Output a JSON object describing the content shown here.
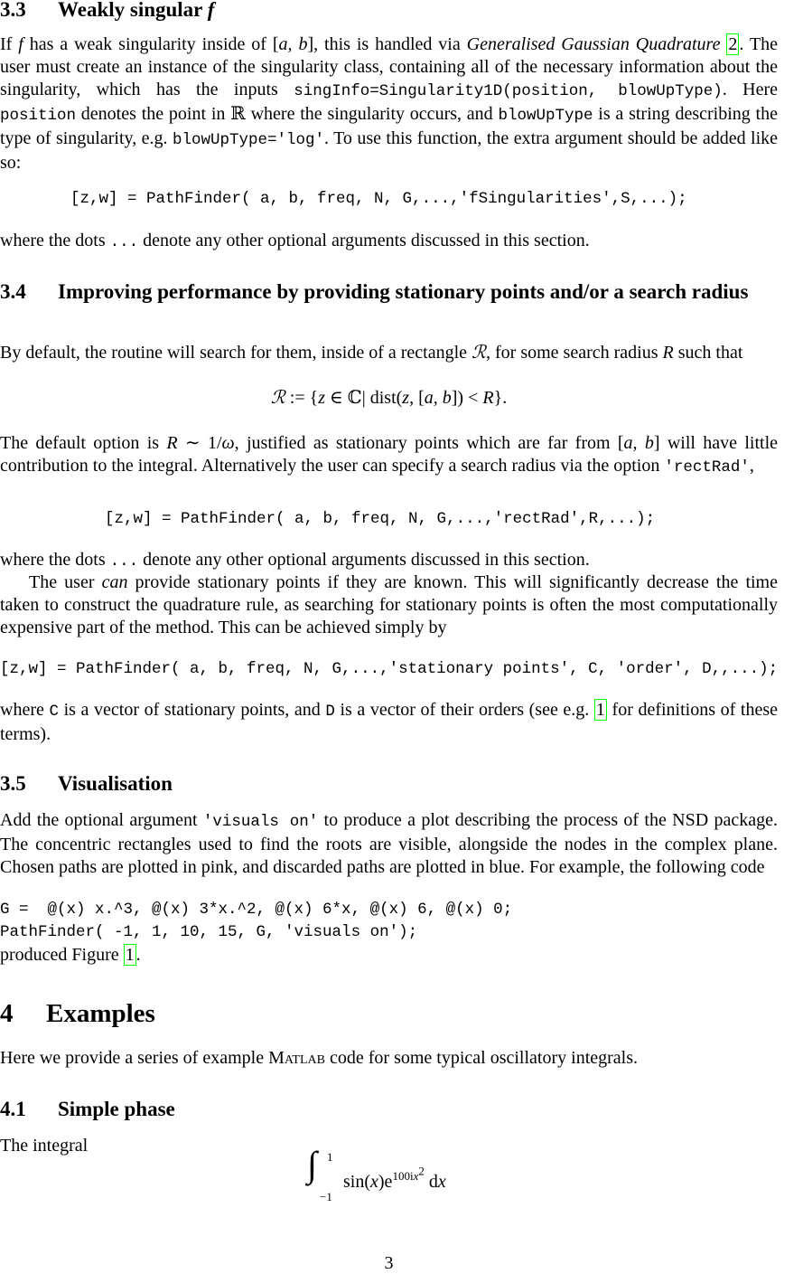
{
  "sections": {
    "s33": {
      "num": "3.3",
      "title": "Weakly singular ",
      "title_math": "f"
    },
    "s34": {
      "num": "3.4",
      "title": "Improving performance by providing stationary points and/or a search radius"
    },
    "s35": {
      "num": "3.5",
      "title": "Visualisation"
    },
    "s4": {
      "num": "4",
      "title": "Examples"
    },
    "s41": {
      "num": "4.1",
      "title": "Simple phase"
    }
  },
  "paras": {
    "p1": [
      [
        "n",
        "If "
      ],
      [
        "m",
        "f"
      ],
      [
        "n",
        " has a weak singularity inside of ["
      ],
      [
        "m",
        "a, b"
      ],
      [
        "n",
        "], this is handled via "
      ],
      [
        "i",
        "Generalised Gaussian Quadrature"
      ],
      [
        "n",
        " "
      ],
      [
        "cite",
        "2"
      ],
      [
        "n",
        ". The user must create an instance of the singularity class, containing all of the necessary information about the singularity, which has the inputs "
      ],
      [
        "c",
        "singInfo=Singularity1D(position, blowUpType)"
      ],
      [
        "n",
        ". Here "
      ],
      [
        "c",
        "position"
      ],
      [
        "n",
        " denotes the point in ℝ where the singularity occurs, and "
      ],
      [
        "c",
        "blowUpType"
      ],
      [
        "n",
        " is a string describing the type of singularity, e.g. "
      ],
      [
        "c",
        "blowUpType='log'"
      ],
      [
        "n",
        ". To use this function, the extra argument should be added like so:"
      ]
    ],
    "p2": [
      [
        "n",
        "where the dots "
      ],
      [
        "c",
        "..."
      ],
      [
        "n",
        " denote any other optional arguments discussed in this section."
      ]
    ],
    "p3": [
      [
        "n",
        "By default, the routine will search for them, inside of a rectangle "
      ],
      [
        "m",
        "ℛ"
      ],
      [
        "n",
        ", for some search radius "
      ],
      [
        "m",
        "R"
      ],
      [
        "n",
        " such that"
      ]
    ],
    "p3math": [
      [
        "m",
        "ℛ"
      ],
      [
        "n",
        " := {"
      ],
      [
        "m",
        "z"
      ],
      [
        "n",
        " ∈ ℂ| dist("
      ],
      [
        "m",
        "z"
      ],
      [
        "n",
        ", ["
      ],
      [
        "m",
        "a, b"
      ],
      [
        "n",
        "]) < "
      ],
      [
        "m",
        "R"
      ],
      [
        "n",
        "}."
      ]
    ],
    "p4": [
      [
        "n",
        "The default option is "
      ],
      [
        "m",
        "R"
      ],
      [
        "n",
        " ∼ 1/"
      ],
      [
        "m",
        "ω"
      ],
      [
        "n",
        ", justified as stationary points which are far from ["
      ],
      [
        "m",
        "a, b"
      ],
      [
        "n",
        "] will have little contribution to the integral.  Alternatively the user can specify a search radius via the option "
      ],
      [
        "c",
        "'rectRad'"
      ],
      [
        "n",
        ","
      ]
    ],
    "p5": [
      [
        "n",
        "where the dots "
      ],
      [
        "c",
        "..."
      ],
      [
        "n",
        " denote any other optional arguments discussed in this section."
      ]
    ],
    "p6": [
      [
        "n",
        "The user "
      ],
      [
        "i",
        "can"
      ],
      [
        "n",
        " provide stationary points if they are known.  This will significantly decrease the time taken to construct the quadrature rule, as searching for stationary points is often the most computationally expensive part of the method. This can be achieved simply by"
      ]
    ],
    "p7": [
      [
        "n",
        "where "
      ],
      [
        "c",
        "C"
      ],
      [
        "n",
        " is a vector of stationary points, and "
      ],
      [
        "c",
        "D"
      ],
      [
        "n",
        " is a vector of their orders (see e.g. "
      ],
      [
        "cite",
        "1"
      ],
      [
        "n",
        " for definitions of these terms)."
      ]
    ],
    "p8": [
      [
        "n",
        "Add the optional argument "
      ],
      [
        "c",
        "'visuals on'"
      ],
      [
        "n",
        " to produce a plot describing the process of the NSD package. The concentric rectangles used to find the roots are visible, alongside the nodes in the complex plane. Chosen paths are plotted in pink, and discarded paths are plotted in blue. For example, the following code"
      ]
    ],
    "p9": [
      [
        "n",
        "produced Figure "
      ],
      [
        "cite",
        "1"
      ],
      [
        "n",
        "."
      ]
    ],
    "p10": [
      [
        "n",
        "Here we provide a series of example "
      ],
      [
        "sc",
        "Matlab"
      ],
      [
        "n",
        " code for some typical oscillatory integrals."
      ]
    ],
    "p11": [
      [
        "n",
        "The integral"
      ]
    ]
  },
  "code": {
    "c1": "[z,w] = PathFinder( a, b, freq, N, G,...,'fSingularities',S,...);",
    "c2": "[z,w] = PathFinder( a, b, freq, N, G,...,'rectRad',R,...);",
    "c3": "[z,w] = PathFinder( a, b, freq, N, G,...,'stationary points', C, 'order', D,,...);",
    "c4": "G =  @(x) x.^3, @(x) 3*x.^2, @(x) 6*x, @(x) 6, @(x) 0;",
    "c5": "PathFinder( -1, 1, 10, 15, G, 'visuals on');"
  },
  "integral": {
    "upper": "1",
    "lower": "−1",
    "func": "sin(",
    "var": "x",
    "close": ")e",
    "exp": "100i",
    "exp_var": "x",
    "exp_pow": "2",
    "d": " d",
    "dvar": "x"
  },
  "page_number": "3",
  "colors": {
    "citation_border": "#00ff00"
  }
}
